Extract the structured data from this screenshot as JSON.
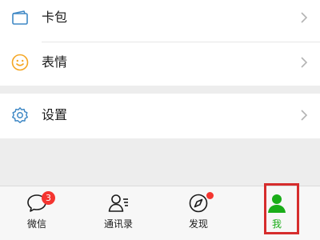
{
  "menu": {
    "kabao": {
      "label": "卡包",
      "icon": "card-wallet-icon"
    },
    "emoji": {
      "label": "表情",
      "icon": "smiley-icon"
    },
    "settings": {
      "label": "设置",
      "icon": "gear-icon"
    }
  },
  "tabbar": {
    "tabs": [
      {
        "label": "微信",
        "icon": "chat-bubble-icon",
        "badge": "3"
      },
      {
        "label": "通讯录",
        "icon": "contacts-icon"
      },
      {
        "label": "发现",
        "icon": "compass-icon"
      },
      {
        "label": "我",
        "icon": "person-icon",
        "selected": true
      }
    ]
  },
  "colors": {
    "accent": "#1aad19",
    "badge": "#f43530",
    "highlight": "#d62d2d",
    "card_icon": "#3f88c5",
    "emoji_icon": "#f5a623",
    "settings_icon": "#3f88c5"
  }
}
